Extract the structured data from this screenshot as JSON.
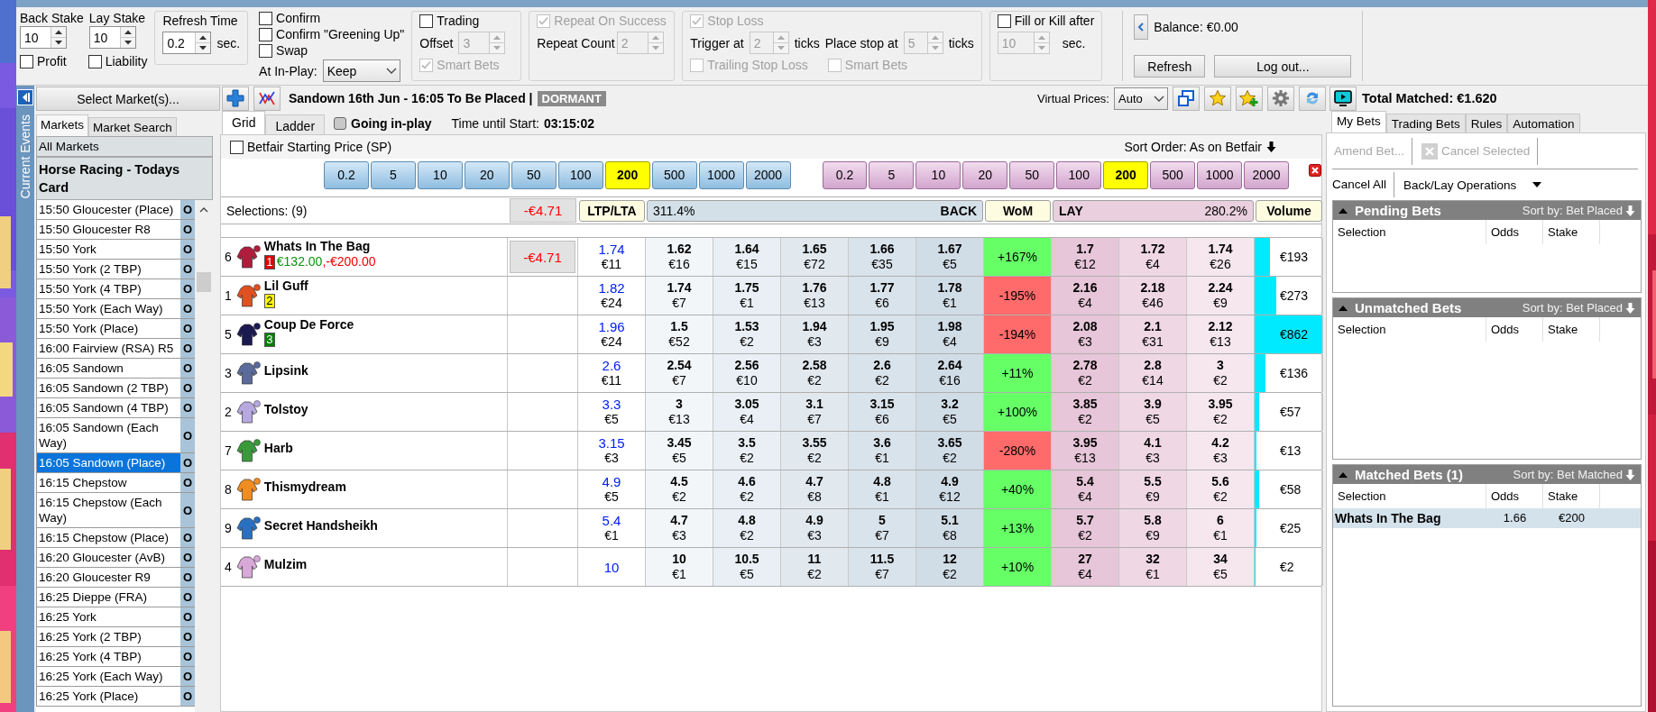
{
  "params": {
    "back_stake": {
      "label": "Back Stake",
      "value": "10",
      "disabled": false
    },
    "lay_stake": {
      "label": "Lay Stake",
      "value": "10",
      "disabled": false
    },
    "profit": {
      "label": "Profit",
      "checked": false
    },
    "liability": {
      "label": "Liability",
      "checked": false
    },
    "refresh": {
      "title": "Refresh Time",
      "value": "0.2",
      "disabled": false,
      "unit": "sec."
    },
    "confirm_options": [
      {
        "label": "Confirm",
        "checked": false
      },
      {
        "label": "Confirm \"Greening Up\"",
        "checked": false
      },
      {
        "label": "Swap",
        "checked": false
      }
    ],
    "in_play": {
      "label": "At In-Play:",
      "value": "Keep"
    },
    "trading": {
      "label": "Trading",
      "checked": false,
      "offset_label": "Offset",
      "offset": {
        "value": "3",
        "disabled": true
      },
      "smart_bets": {
        "label": "Smart Bets",
        "checked": true,
        "disabled": true
      }
    },
    "repeat": {
      "label": "Repeat On Success",
      "checked": true,
      "disabled": true,
      "count_label": "Repeat Count",
      "count": {
        "value": "2",
        "disabled": true
      }
    },
    "stop_loss": {
      "label": "Stop Loss",
      "checked": true,
      "disabled": true,
      "trigger_label": "Trigger at",
      "trigger": {
        "value": "2",
        "disabled": true
      },
      "trigger_unit": "ticks",
      "place_label": "Place stop at",
      "place": {
        "value": "5",
        "disabled": true
      },
      "place_unit": "ticks",
      "trailing": {
        "label": "Trailing Stop Loss",
        "checked": false,
        "disabled": true
      },
      "smart_bets": {
        "label": "Smart Bets",
        "checked": false,
        "disabled": true
      }
    },
    "fill_or_kill": {
      "label": "Fill or Kill after",
      "checked": false,
      "time": {
        "value": "10",
        "disabled": true
      },
      "unit": "sec."
    },
    "account": {
      "balance": "Balance: €0.00",
      "buttons": [
        "Refresh",
        "Log out..."
      ]
    }
  },
  "rail": {
    "label": "Current Events"
  },
  "sidebar": {
    "select_button": "Select Market(s)...",
    "tabs": [
      {
        "label": "Markets",
        "selected": true
      },
      {
        "label": "Market Search",
        "selected": false
      }
    ],
    "groups": [
      "All Markets",
      "Horse Racing - Todays Card"
    ],
    "markets": [
      {
        "name": "15:50 Gloucester (Place)",
        "status": "O",
        "selected": false
      },
      {
        "name": "15:50 Gloucester R8",
        "status": "O",
        "selected": false
      },
      {
        "name": "15:50 York",
        "status": "O",
        "selected": false
      },
      {
        "name": "15:50 York (2 TBP)",
        "status": "O",
        "selected": false
      },
      {
        "name": "15:50 York (4 TBP)",
        "status": "O",
        "selected": false
      },
      {
        "name": "15:50 York (Each Way)",
        "status": "O",
        "selected": false
      },
      {
        "name": "15:50 York (Place)",
        "status": "O",
        "selected": false
      },
      {
        "name": "16:00 Fairview (RSA) R5",
        "status": "O",
        "selected": false
      },
      {
        "name": "16:05 Sandown",
        "status": "O",
        "selected": false
      },
      {
        "name": "16:05 Sandown (2 TBP)",
        "status": "O",
        "selected": false
      },
      {
        "name": "16:05 Sandown (4 TBP)",
        "status": "O",
        "selected": false
      },
      {
        "name": "16:05 Sandown (Each Way)",
        "status": "O",
        "selected": false
      },
      {
        "name": "16:05 Sandown (Place)",
        "status": "O",
        "selected": true
      },
      {
        "name": "16:15 Chepstow",
        "status": "O",
        "selected": false
      },
      {
        "name": "16:15 Chepstow (Each Way)",
        "status": "O",
        "selected": false
      },
      {
        "name": "16:15 Chepstow (Place)",
        "status": "O",
        "selected": false
      },
      {
        "name": "16:20 Gloucester (AvB)",
        "status": "O",
        "selected": false
      },
      {
        "name": "16:20 Gloucester R9",
        "status": "O",
        "selected": false
      },
      {
        "name": "16:25 Dieppe (FRA)",
        "status": "O",
        "selected": false
      },
      {
        "name": "16:25 York",
        "status": "O",
        "selected": false
      },
      {
        "name": "16:25 York (2 TBP)",
        "status": "O",
        "selected": false
      },
      {
        "name": "16:25 York (4 TBP)",
        "status": "O",
        "selected": false
      },
      {
        "name": "16:25 York (Each Way)",
        "status": "O",
        "selected": false
      },
      {
        "name": "16:25 York (Place)",
        "status": "O",
        "selected": false
      }
    ]
  },
  "toolbar": {
    "market_title": "Sandown 16th Jun - 16:05 To Be Placed |",
    "status": "DORMANT",
    "virtual_prices": {
      "label": "Virtual Prices:",
      "value": "Auto"
    },
    "total_matched": "Total Matched: €1.620"
  },
  "grid": {
    "tabs": [
      {
        "label": "Grid",
        "selected": true
      },
      {
        "label": "Ladder",
        "selected": false
      }
    ],
    "going_in_play": {
      "label": "Going in-play",
      "on": false
    },
    "time_label": "Time until Start:",
    "time": "03:15:02",
    "sp": {
      "label": "Betfair Starting Price (SP)",
      "checked": false
    },
    "sort": "Sort Order: As on Betfair",
    "back_stakes": [
      {
        "label": "0.2",
        "selected": false
      },
      {
        "label": "5",
        "selected": false
      },
      {
        "label": "10",
        "selected": false
      },
      {
        "label": "20",
        "selected": false
      },
      {
        "label": "50",
        "selected": false
      },
      {
        "label": "100",
        "selected": false
      },
      {
        "label": "200",
        "selected": true
      },
      {
        "label": "500",
        "selected": false
      },
      {
        "label": "1000",
        "selected": false
      },
      {
        "label": "2000",
        "selected": false
      }
    ],
    "lay_stakes": [
      {
        "label": "0.2",
        "selected": false
      },
      {
        "label": "5",
        "selected": false
      },
      {
        "label": "10",
        "selected": false
      },
      {
        "label": "20",
        "selected": false
      },
      {
        "label": "50",
        "selected": false
      },
      {
        "label": "100",
        "selected": false
      },
      {
        "label": "200",
        "selected": true
      },
      {
        "label": "500",
        "selected": false
      },
      {
        "label": "1000",
        "selected": false
      },
      {
        "label": "2000",
        "selected": false
      }
    ],
    "header": {
      "selections": "Selections: (9)",
      "profit": "-€4.71",
      "ltp": "LTP/LTA",
      "back_pct": "311.4%",
      "back": "BACK",
      "wom": "WoM",
      "lay": "LAY",
      "lay_pct": "280.2%",
      "volume": "Volume"
    },
    "runners": [
      {
        "number": "6",
        "name": "Whats In The Bag",
        "color": "#b01c3c",
        "badge": {
          "text": "1",
          "color": "#e00000"
        },
        "position": [
          {
            "text": "€132.00",
            "positive": true
          },
          {
            "text": ",-€200.00",
            "positive": false
          }
        ],
        "profit": "-€4.71",
        "ltp": "1.74",
        "ltp_amount": "€11",
        "back": [
          {
            "price": "1.62",
            "amount": "€16"
          },
          {
            "price": "1.64",
            "amount": "€15"
          },
          {
            "price": "1.65",
            "amount": "€72"
          },
          {
            "price": "1.66",
            "amount": "€35"
          },
          {
            "price": "1.67",
            "amount": "€5"
          }
        ],
        "wom": "+167%",
        "wom_positive": true,
        "lay": [
          {
            "price": "1.7",
            "amount": "€12"
          },
          {
            "price": "1.72",
            "amount": "€4"
          },
          {
            "price": "1.74",
            "amount": "€26"
          }
        ],
        "volume": "€193",
        "level": 0.22
      },
      {
        "number": "1",
        "name": "Lil Guff",
        "color": "#e05020",
        "badge": {
          "text": "2",
          "color": "#ffff00"
        },
        "ltp": "1.82",
        "ltp_amount": "€24",
        "back": [
          {
            "price": "1.74",
            "amount": "€7"
          },
          {
            "price": "1.75",
            "amount": "€1"
          },
          {
            "price": "1.76",
            "amount": "€13"
          },
          {
            "price": "1.77",
            "amount": "€6"
          },
          {
            "price": "1.78",
            "amount": "€1"
          }
        ],
        "wom": "-195%",
        "wom_positive": false,
        "lay": [
          {
            "price": "2.16",
            "amount": "€4"
          },
          {
            "price": "2.18",
            "amount": "€46"
          },
          {
            "price": "2.24",
            "amount": "€9"
          }
        ],
        "volume": "€273",
        "level": 0.32
      },
      {
        "number": "5",
        "name": "Coup De Force",
        "color": "#1a1a50",
        "badge": {
          "text": "3",
          "color": "#008000"
        },
        "ltp": "1.96",
        "ltp_amount": "€24",
        "back": [
          {
            "price": "1.5",
            "amount": "€52"
          },
          {
            "price": "1.53",
            "amount": "€2"
          },
          {
            "price": "1.94",
            "amount": "€3"
          },
          {
            "price": "1.95",
            "amount": "€9"
          },
          {
            "price": "1.98",
            "amount": "€4"
          }
        ],
        "wom": "-194%",
        "wom_positive": false,
        "lay": [
          {
            "price": "2.08",
            "amount": "€3"
          },
          {
            "price": "2.1",
            "amount": "€31"
          },
          {
            "price": "2.12",
            "amount": "€13"
          }
        ],
        "volume": "€862",
        "level": 1
      },
      {
        "number": "3",
        "name": "Lipsink",
        "color": "#5a6a9a",
        "ltp": "2.6",
        "ltp_amount": "€11",
        "back": [
          {
            "price": "2.54",
            "amount": "€7"
          },
          {
            "price": "2.56",
            "amount": "€10"
          },
          {
            "price": "2.58",
            "amount": "€2"
          },
          {
            "price": "2.6",
            "amount": "€2"
          },
          {
            "price": "2.64",
            "amount": "€16"
          }
        ],
        "wom": "+11%",
        "wom_positive": true,
        "lay": [
          {
            "price": "2.78",
            "amount": "€2"
          },
          {
            "price": "2.8",
            "amount": "€14"
          },
          {
            "price": "3",
            "amount": "€2"
          }
        ],
        "volume": "€136",
        "level": 0.16
      },
      {
        "number": "2",
        "name": "Tolstoy",
        "color": "#b8a8e0",
        "ltp": "3.3",
        "ltp_amount": "€5",
        "back": [
          {
            "price": "3",
            "amount": "€13"
          },
          {
            "price": "3.05",
            "amount": "€4"
          },
          {
            "price": "3.1",
            "amount": "€7"
          },
          {
            "price": "3.15",
            "amount": "€6"
          },
          {
            "price": "3.2",
            "amount": "€5"
          }
        ],
        "wom": "+100%",
        "wom_positive": true,
        "lay": [
          {
            "price": "3.85",
            "amount": "€2"
          },
          {
            "price": "3.9",
            "amount": "€5"
          },
          {
            "price": "3.95",
            "amount": "€2"
          }
        ],
        "volume": "€57",
        "level": 0.07
      },
      {
        "number": "7",
        "name": "Harb",
        "color": "#3a9a3a",
        "ltp": "3.15",
        "ltp_amount": "€3",
        "back": [
          {
            "price": "3.45",
            "amount": "€5"
          },
          {
            "price": "3.5",
            "amount": "€2"
          },
          {
            "price": "3.55",
            "amount": "€2"
          },
          {
            "price": "3.6",
            "amount": "€1"
          },
          {
            "price": "3.65",
            "amount": "€2"
          }
        ],
        "wom": "-280%",
        "wom_positive": false,
        "lay": [
          {
            "price": "3.95",
            "amount": "€13"
          },
          {
            "price": "4.1",
            "amount": "€3"
          },
          {
            "price": "4.2",
            "amount": "€3"
          }
        ],
        "volume": "€13",
        "level": 0.02
      },
      {
        "number": "8",
        "name": "Thismydream",
        "color": "#f08c20",
        "ltp": "4.9",
        "ltp_amount": "€5",
        "back": [
          {
            "price": "4.5",
            "amount": "€2"
          },
          {
            "price": "4.6",
            "amount": "€2"
          },
          {
            "price": "4.7",
            "amount": "€8"
          },
          {
            "price": "4.8",
            "amount": "€1"
          },
          {
            "price": "4.9",
            "amount": "€12"
          }
        ],
        "wom": "+40%",
        "wom_positive": true,
        "lay": [
          {
            "price": "5.4",
            "amount": "€4"
          },
          {
            "price": "5.5",
            "amount": "€9"
          },
          {
            "price": "5.6",
            "amount": "€2"
          }
        ],
        "volume": "€58",
        "level": 0.07
      },
      {
        "number": "9",
        "name": "Secret Handsheikh",
        "color": "#2a70c0",
        "ltp": "5.4",
        "ltp_amount": "€1",
        "back": [
          {
            "price": "4.7",
            "amount": "€3"
          },
          {
            "price": "4.8",
            "amount": "€2"
          },
          {
            "price": "4.9",
            "amount": "€3"
          },
          {
            "price": "5",
            "amount": "€7"
          },
          {
            "price": "5.1",
            "amount": "€8"
          }
        ],
        "wom": "+13%",
        "wom_positive": true,
        "lay": [
          {
            "price": "5.7",
            "amount": "€2"
          },
          {
            "price": "5.8",
            "amount": "€9"
          },
          {
            "price": "6",
            "amount": "€1"
          }
        ],
        "volume": "€25",
        "level": 0.03
      },
      {
        "number": "4",
        "name": "Mulzim",
        "color": "#d8a8d8",
        "ltp": "10",
        "back": [
          {
            "price": "10",
            "amount": "€1"
          },
          {
            "price": "10.5",
            "amount": "€5"
          },
          {
            "price": "11",
            "amount": "€2"
          },
          {
            "price": "11.5",
            "amount": "€7"
          },
          {
            "price": "12",
            "amount": "€2"
          }
        ],
        "wom": "+10%",
        "wom_positive": true,
        "lay": [
          {
            "price": "27",
            "amount": "€4"
          },
          {
            "price": "32",
            "amount": "€1"
          },
          {
            "price": "34",
            "amount": "€5"
          }
        ],
        "volume": "€2",
        "level": 0.01
      }
    ]
  },
  "bets": {
    "tabs": [
      {
        "label": "My Bets",
        "selected": true
      },
      {
        "label": "Trading Bets",
        "selected": false
      },
      {
        "label": "Rules",
        "selected": false
      },
      {
        "label": "Automation",
        "selected": false
      }
    ],
    "actions": [
      {
        "label": "Amend Bet...",
        "disabled": true
      },
      {
        "label": "Cancel Selected",
        "disabled": true
      }
    ],
    "cancel_all": "Cancel All",
    "operations": "Back/Lay Operations",
    "sections": [
      {
        "title": "Pending Bets",
        "sort": "Sort by: Bet Placed",
        "columns": [
          "Selection",
          "Odds",
          "Stake"
        ]
      },
      {
        "title": "Unmatched Bets",
        "sort": "Sort by: Bet Placed",
        "columns": [
          "Selection",
          "Odds",
          "Stake"
        ]
      },
      {
        "title": "Matched Bets (1)",
        "sort": "Sort by: Bet Matched",
        "columns": [
          "Selection",
          "Odds",
          "Stake"
        ],
        "rows": [
          {
            "selection": "Whats In The Bag",
            "odds": "1.66",
            "stake": "€200",
            "selected": true
          }
        ]
      }
    ]
  }
}
